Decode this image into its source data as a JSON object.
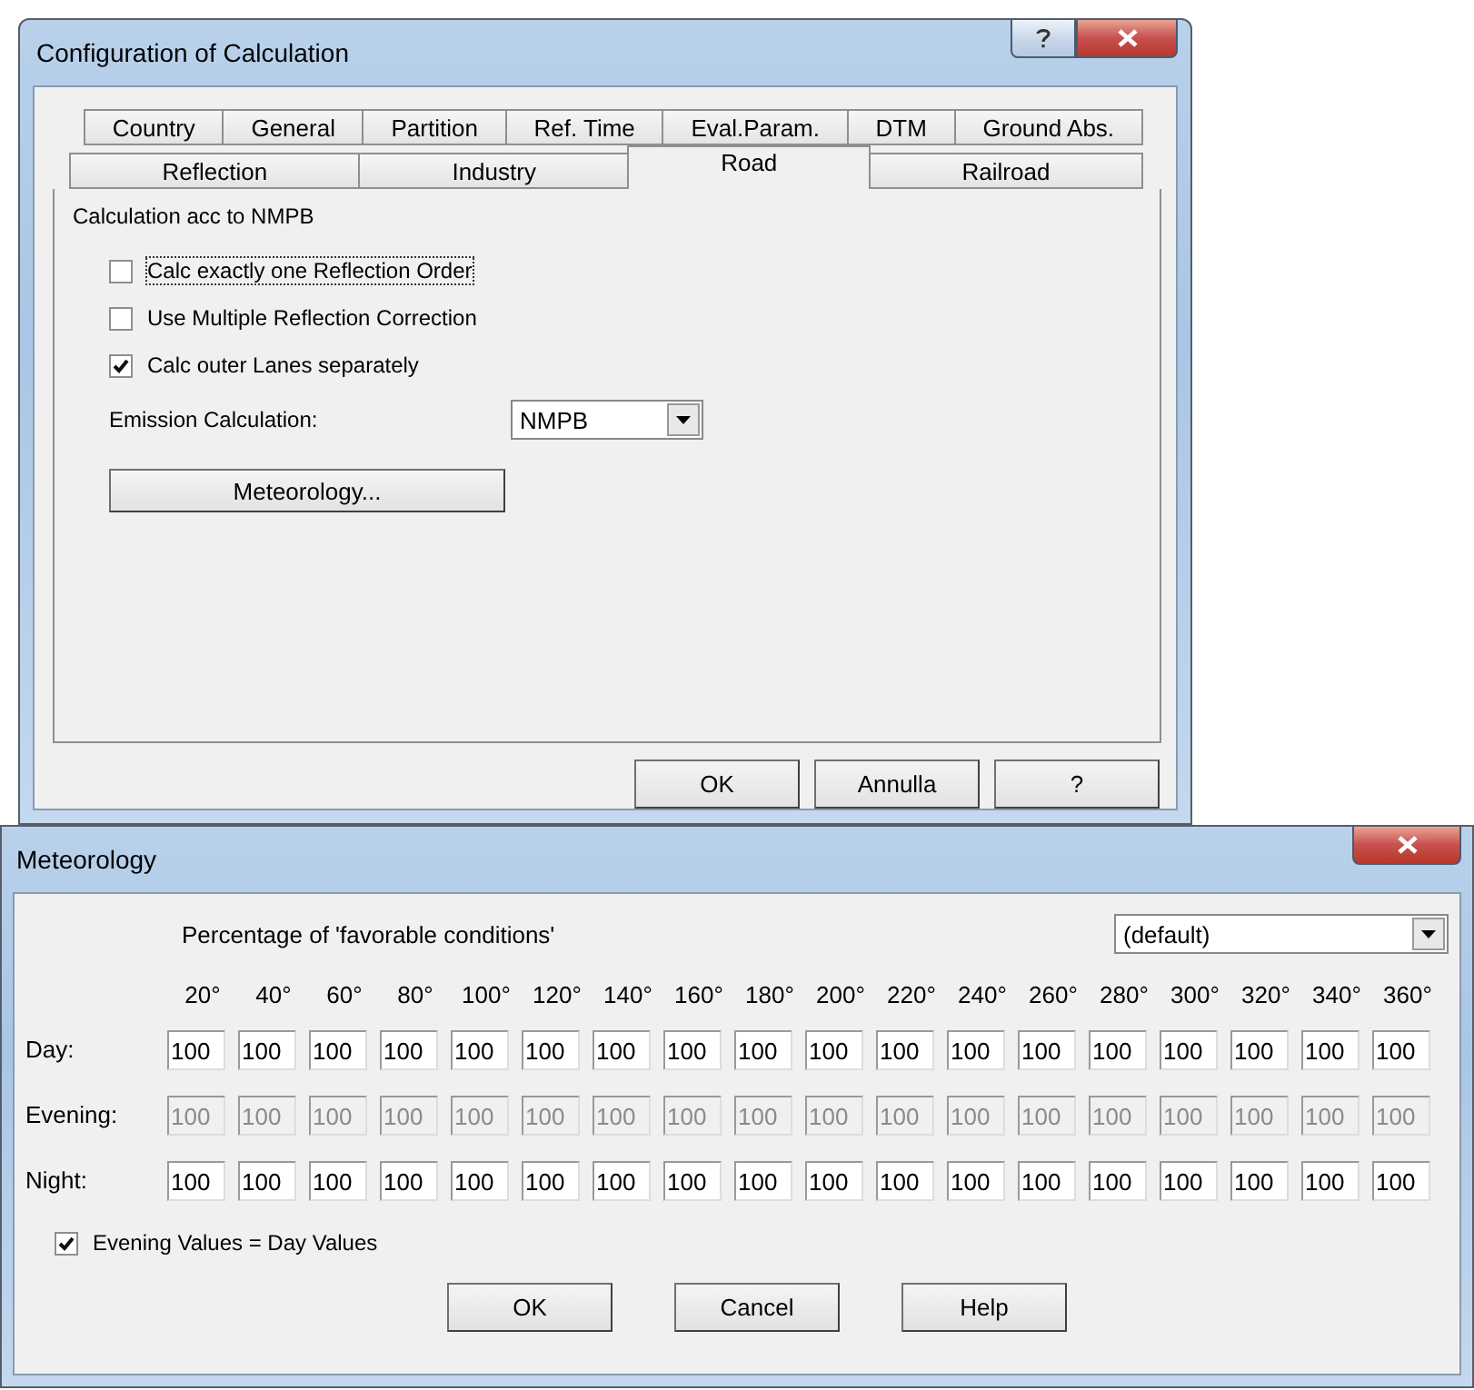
{
  "config": {
    "title": "Configuration of Calculation",
    "tab_rows": [
      [
        {
          "label": "Country",
          "selected": false
        },
        {
          "label": "General",
          "selected": false
        },
        {
          "label": "Partition",
          "selected": false
        },
        {
          "label": "Ref. Time",
          "selected": false
        },
        {
          "label": "Eval.Param.",
          "selected": false
        },
        {
          "label": "DTM",
          "selected": false
        },
        {
          "label": "Ground Abs.",
          "selected": false
        }
      ],
      [
        {
          "label": "Reflection",
          "selected": false
        },
        {
          "label": "Industry",
          "selected": false
        },
        {
          "label": "Road",
          "selected": true
        },
        {
          "label": "Railroad",
          "selected": false
        }
      ]
    ],
    "heading": "Calculation acc to NMPB",
    "checkboxes": [
      {
        "label": "Calc exactly one Reflection Order",
        "checked": false,
        "focused": true
      },
      {
        "label": "Use Multiple Reflection Correction",
        "checked": false,
        "focused": false
      },
      {
        "label": "Calc outer Lanes separately",
        "checked": true,
        "focused": false
      }
    ],
    "emission": {
      "label": "Emission Calculation:",
      "value": "NMPB"
    },
    "meteorology_button": "Meteorology...",
    "buttons": [
      "OK",
      "Annulla",
      "?"
    ]
  },
  "meteorology": {
    "title": "Meteorology",
    "heading": "Percentage of 'favorable conditions'",
    "preset": "(default)",
    "angles": [
      "20°",
      "40°",
      "60°",
      "80°",
      "100°",
      "120°",
      "140°",
      "160°",
      "180°",
      "200°",
      "220°",
      "240°",
      "260°",
      "280°",
      "300°",
      "320°",
      "340°",
      "360°"
    ],
    "rows": [
      {
        "label": "Day:",
        "disabled": false,
        "values": [
          "100",
          "100",
          "100",
          "100",
          "100",
          "100",
          "100",
          "100",
          "100",
          "100",
          "100",
          "100",
          "100",
          "100",
          "100",
          "100",
          "100",
          "100"
        ]
      },
      {
        "label": "Evening:",
        "disabled": true,
        "values": [
          "100",
          "100",
          "100",
          "100",
          "100",
          "100",
          "100",
          "100",
          "100",
          "100",
          "100",
          "100",
          "100",
          "100",
          "100",
          "100",
          "100",
          "100"
        ]
      },
      {
        "label": "Night:",
        "disabled": false,
        "values": [
          "100",
          "100",
          "100",
          "100",
          "100",
          "100",
          "100",
          "100",
          "100",
          "100",
          "100",
          "100",
          "100",
          "100",
          "100",
          "100",
          "100",
          "100"
        ]
      }
    ],
    "checkbox": {
      "label": "Evening Values = Day Values",
      "checked": true
    },
    "buttons": [
      "OK",
      "Cancel",
      "Help"
    ]
  }
}
